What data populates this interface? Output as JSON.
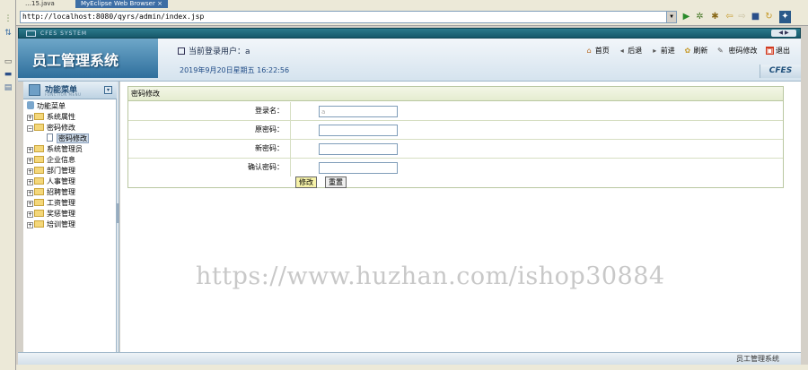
{
  "ide": {
    "tabs": [
      "…15.java",
      "MyEclipse Web Browser"
    ],
    "close_glyph": "×"
  },
  "browser": {
    "url": "http://localhost:8080/qyrs/admin/index.jsp"
  },
  "app": {
    "strip_label": "CFES SYSTEM",
    "logo_title": "员工管理系统",
    "current_user_label": "当前登录用户：",
    "current_user": "a",
    "datetime": "2019年9月20日星期五  16:22:56",
    "brand_badge": "CFES",
    "toolbar": {
      "home": "首页",
      "back": "后退",
      "forward": "前进",
      "refresh": "刷新",
      "change_password": "密码修改",
      "logout": "退出"
    }
  },
  "sidebar": {
    "title": "功能菜单",
    "subtitle": "FUNCTION MENU",
    "root": "功能菜单",
    "items": [
      {
        "label": "系统属性",
        "expanded": false
      },
      {
        "label": "密码修改",
        "expanded": true
      },
      {
        "label": "密码修改",
        "child": true,
        "selected": true
      },
      {
        "label": "系统管理员",
        "expanded": false
      },
      {
        "label": "企业信息",
        "expanded": false
      },
      {
        "label": "部门管理",
        "expanded": false
      },
      {
        "label": "人事管理",
        "expanded": false
      },
      {
        "label": "招聘管理",
        "expanded": false
      },
      {
        "label": "工资管理",
        "expanded": false
      },
      {
        "label": "奖惩管理",
        "expanded": false
      },
      {
        "label": "培训管理",
        "expanded": false
      }
    ]
  },
  "form": {
    "title": "密码修改",
    "fields": {
      "login_name": {
        "label": "登录名：",
        "value": "a"
      },
      "old_password": {
        "label": "原密码：",
        "value": ""
      },
      "new_password": {
        "label": "新密码：",
        "value": ""
      },
      "confirm_password": {
        "label": "确认密码：",
        "value": ""
      }
    },
    "submit_label": "修改",
    "reset_label": "重置"
  },
  "watermark": "https://www.huzhan.com/ishop30884",
  "footer": {
    "text": "员工管理系统"
  },
  "colors": {
    "header_teal": "#16586a",
    "panel_border": "#b9c7a1",
    "submit_yellow": "#f6f2a8"
  }
}
